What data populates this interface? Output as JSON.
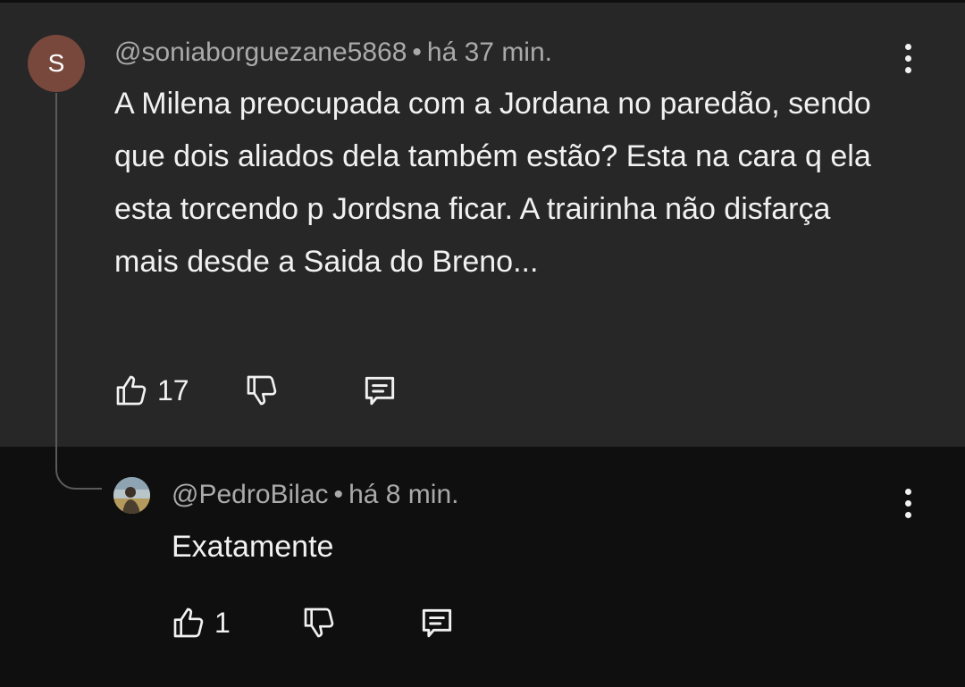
{
  "comment": {
    "avatar_letter": "S",
    "author": "@soniaborguezane5868",
    "separator": "•",
    "time": "há 37 min.",
    "text": "A Milena preocupada com a  Jordana no paredão,  sendo que dois aliados dela também estão? Esta na cara q ela esta torcendo p Jordsna ficar. A trairinha não disfarça mais desde a Saida do Breno...",
    "likes": "17",
    "icons": {
      "like": "thumb-up-icon",
      "dislike": "thumb-down-icon",
      "reply": "reply-comment-icon",
      "more": "more-vert-icon"
    }
  },
  "reply": {
    "author": "@PedroBilac",
    "separator": "•",
    "time": "há 8 min.",
    "text": "Exatamente",
    "likes": "1"
  },
  "colors": {
    "background": "#0f0f0f",
    "parent_background": "#272727",
    "avatar_background": "#79483d",
    "meta_text": "#aaaaaa",
    "main_text": "#f1f1f1",
    "thread_line": "#5a5a5a"
  }
}
